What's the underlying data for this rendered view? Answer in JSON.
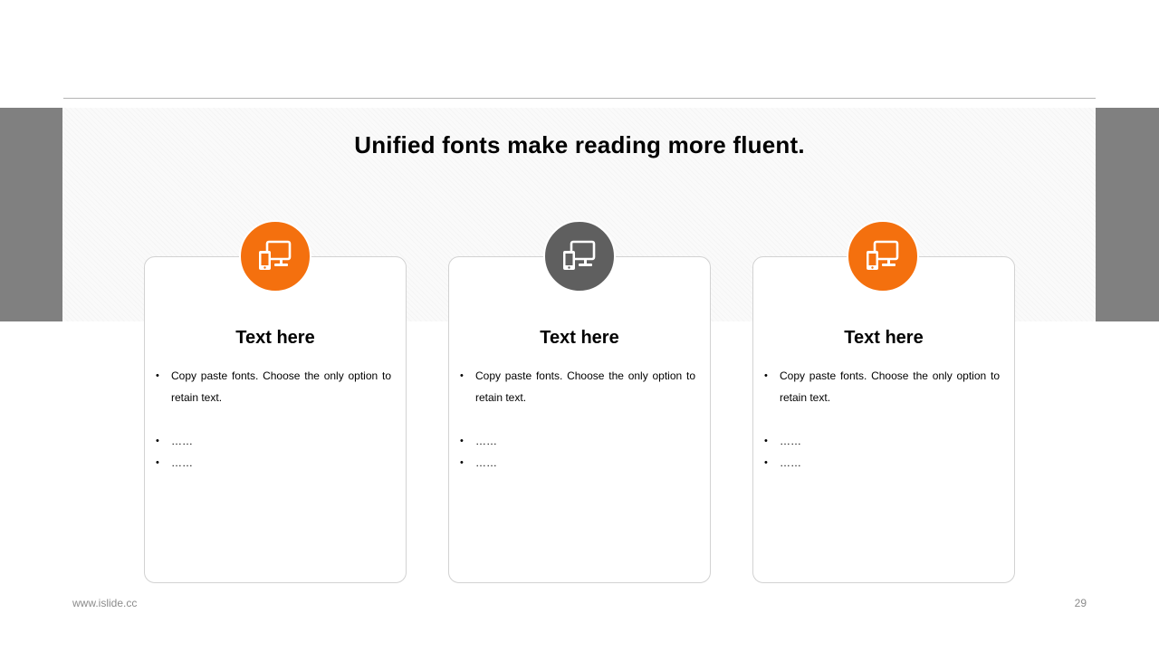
{
  "slide": {
    "headline": "Unified fonts make reading more fluent."
  },
  "cards": [
    {
      "icon": "devices-icon",
      "icon_color": "#F4700E",
      "title": "Text here",
      "bullets": [
        "Copy paste fonts. Choose the only option to retain text.",
        "……",
        "……"
      ]
    },
    {
      "icon": "devices-icon",
      "icon_color": "#5F5F5F",
      "title": "Text here",
      "bullets": [
        "Copy paste fonts. Choose the only option to retain text.",
        "……",
        "……"
      ]
    },
    {
      "icon": "devices-icon",
      "icon_color": "#F4700E",
      "title": "Text here",
      "bullets": [
        "Copy paste fonts. Choose the only option to retain text.",
        "……",
        "……"
      ]
    }
  ],
  "footer": {
    "url": "www.islide.cc",
    "page_number": "29"
  },
  "colors": {
    "accent": "#F4700E",
    "dark": "#5F5F5F",
    "band": "#808080"
  }
}
